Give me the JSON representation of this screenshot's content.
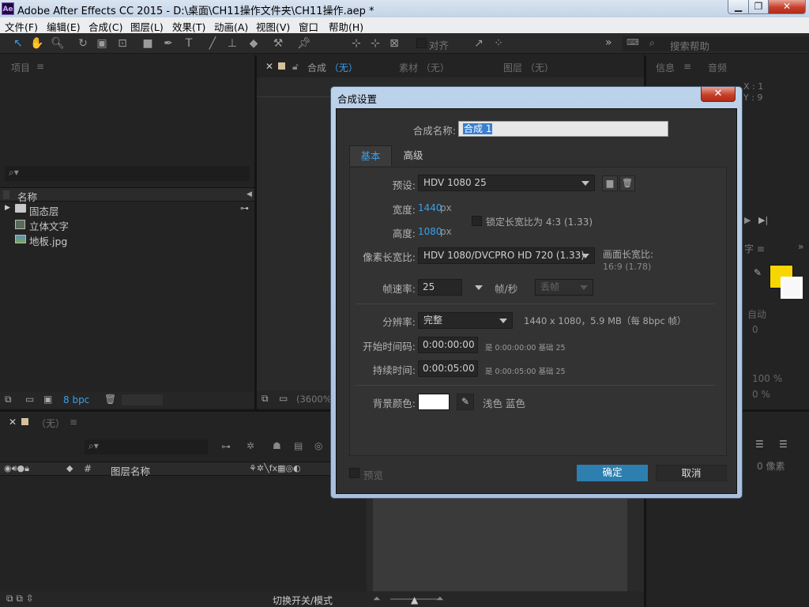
{
  "window": {
    "app_icon": "Ae",
    "title": "Adobe After Effects CC 2015 - D:\\桌面\\CH11操作文件夹\\CH11操作.aep *",
    "controls": [
      "minimize-icon",
      "restore-icon",
      "close-icon"
    ]
  },
  "menu": [
    "文件(F)",
    "编辑(E)",
    "合成(C)",
    "图层(L)",
    "效果(T)",
    "动画(A)",
    "视图(V)",
    "窗口",
    "帮助(H)"
  ],
  "toolbar": {
    "align_label": "对齐",
    "search_placeholder": "搜索帮助",
    "more": "»"
  },
  "project_panel": {
    "tab": "项目",
    "menu": "≡",
    "column_name": "名称",
    "items": [
      {
        "label": "固态层",
        "type": "folder"
      },
      {
        "label": "立体文字",
        "type": "comp"
      },
      {
        "label": "地板.jpg",
        "type": "image"
      }
    ],
    "bpc": "8 bpc"
  },
  "viewer": {
    "tabs": [
      {
        "label": "合成",
        "value": "（无）"
      },
      {
        "label": "素材",
        "value": "（无）"
      },
      {
        "label": "图层",
        "value": "（无）"
      }
    ],
    "zoom": "(3600%"
  },
  "info_panel": {
    "tabs": [
      "信息",
      "音频"
    ],
    "x": "X : 1",
    "y": "Y : 9"
  },
  "timeline": {
    "tab": "（无）",
    "col_layer_name": "图层名称",
    "col_hash": "#",
    "switch_mode": "切换开关/模式"
  },
  "right_panels": {
    "auto": "自动",
    "zero": "0",
    "pct1": "100 %",
    "pct2": "0 %",
    "px": "0 像素",
    "color": "#f7d600"
  },
  "dialog": {
    "title": "合成设置",
    "close": "✕",
    "name_label": "合成名称:",
    "name_value": "合成 1",
    "tabs": [
      {
        "label": "基本",
        "active": true
      },
      {
        "label": "高级",
        "active": false
      }
    ],
    "preset_label": "预设:",
    "preset_value": "HDV 1080 25",
    "width_label": "宽度:",
    "width_value": "1440",
    "width_unit": "px",
    "height_label": "高度:",
    "height_value": "1080",
    "height_unit": "px",
    "lock_ratio_label": "锁定长宽比为 4:3 (1.33)",
    "pixel_ratio_label": "像素长宽比:",
    "pixel_ratio_value": "HDV 1080/DVCPRO HD 720 (1.33)",
    "frame_ratio_label": "画面长宽比:",
    "frame_ratio_value": "16:9 (1.78)",
    "fps_label": "帧速率:",
    "fps_value": "25",
    "fps_unit": "帧/秒",
    "drop_frame": "丢帧",
    "resolution_label": "分辨率:",
    "resolution_value": "完整",
    "resolution_info": "1440 x 1080，5.9 MB（每 8bpc 帧）",
    "start_tc_label": "开始时间码:",
    "start_tc_value": "0:00:00:00",
    "start_tc_info": "是 0:00:00:00  基础 25",
    "duration_label": "持续时间:",
    "duration_value": "0:00:05:00",
    "duration_info": "是 0:00:05:00  基础 25",
    "bg_label": "背景颜色:",
    "bg_value": "浅色 蓝色",
    "bg_color": "#ffffff",
    "preview_label": "预览",
    "ok": "确定",
    "cancel": "取消",
    "accent": "#2d7fb0"
  }
}
